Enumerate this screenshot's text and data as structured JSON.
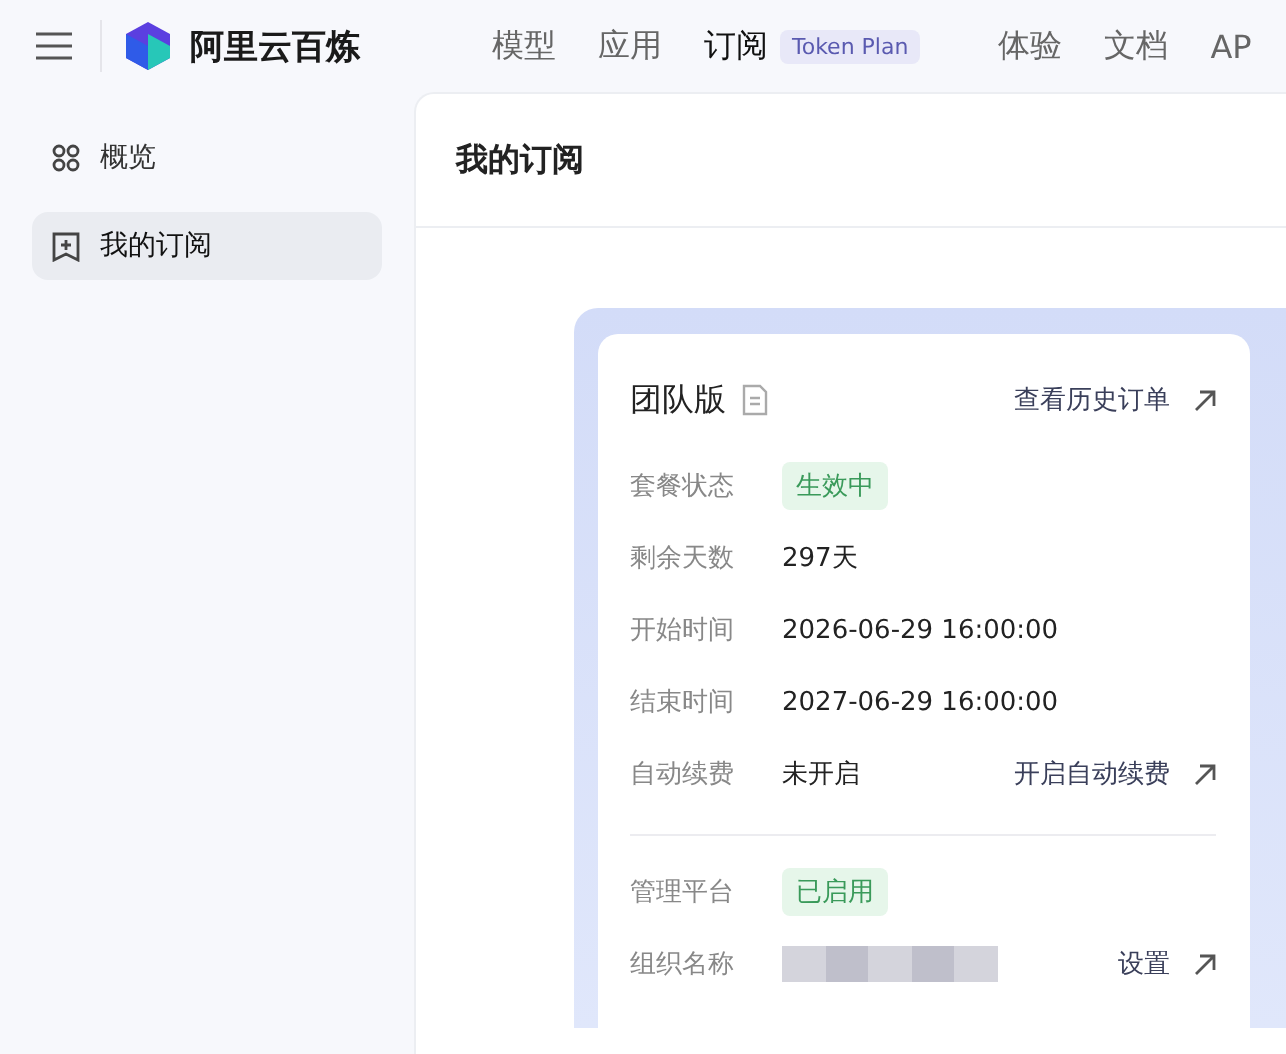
{
  "topbar": {
    "brand": "阿里云百炼",
    "nav": [
      {
        "label": "模型",
        "selected": false
      },
      {
        "label": "应用",
        "selected": false
      },
      {
        "label": "订阅",
        "selected": true,
        "badge": "Token Plan"
      },
      {
        "label": "体验",
        "selected": false
      },
      {
        "label": "文档",
        "selected": false
      },
      {
        "label": "AP",
        "selected": false
      }
    ]
  },
  "sidebar": {
    "items": [
      {
        "label": "概览",
        "selected": false
      },
      {
        "label": "我的订阅",
        "selected": true
      }
    ]
  },
  "page": {
    "title": "我的订阅"
  },
  "plan_card": {
    "title": "团队版",
    "history_link": "查看历史订单",
    "sections": [
      [
        {
          "label": "套餐状态",
          "kind": "badge",
          "value": "生效中"
        },
        {
          "label": "剩余天数",
          "kind": "text",
          "value": "297天"
        },
        {
          "label": "开始时间",
          "kind": "text",
          "value": "2026-06-29 16:00:00"
        },
        {
          "label": "结束时间",
          "kind": "text",
          "value": "2027-06-29 16:00:00"
        },
        {
          "label": "自动续费",
          "kind": "text",
          "value": "未开启",
          "action": "开启自动续费"
        }
      ],
      [
        {
          "label": "管理平台",
          "kind": "badge",
          "value": "已启用"
        },
        {
          "label": "组织名称",
          "kind": "redacted",
          "action": "设置"
        }
      ]
    ]
  }
}
